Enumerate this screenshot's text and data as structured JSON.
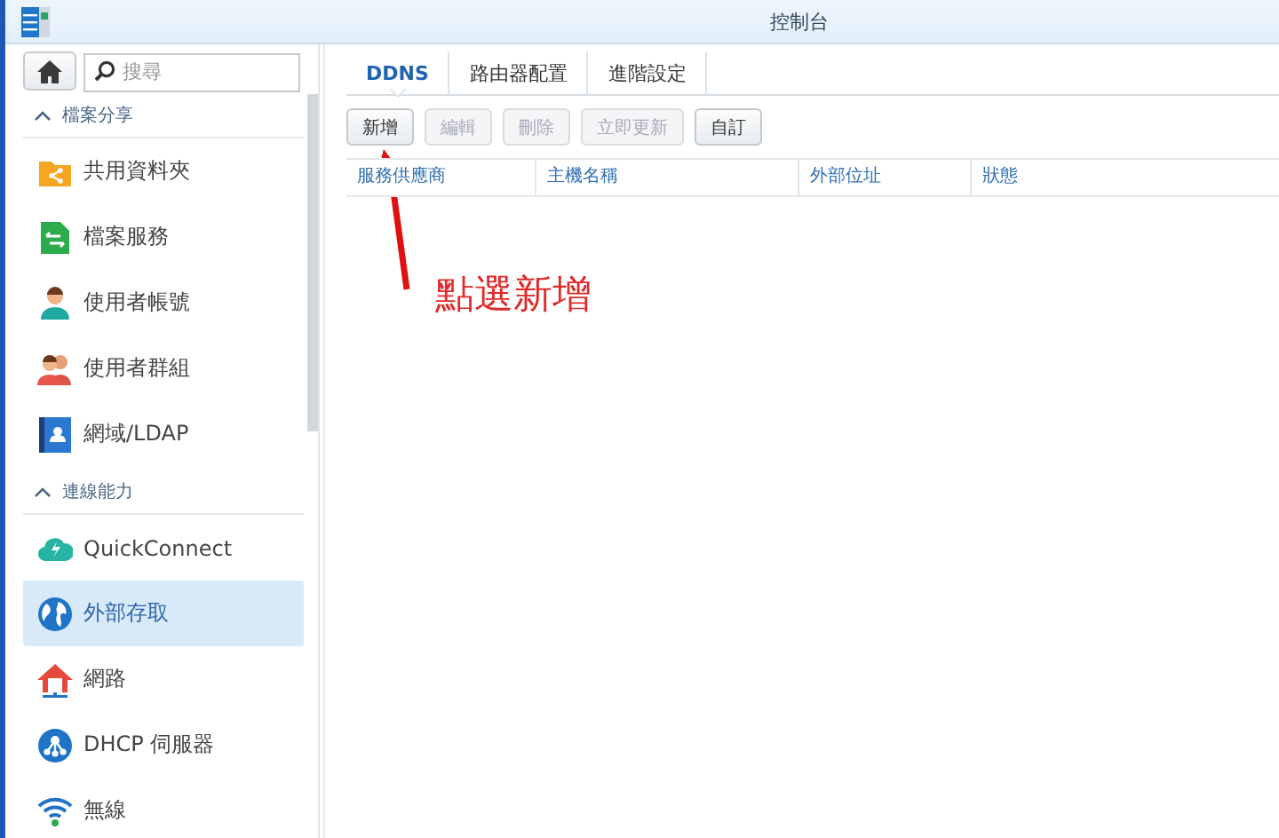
{
  "window": {
    "title": "控制台"
  },
  "search": {
    "placeholder": "搜尋"
  },
  "sidebar": {
    "sections": [
      {
        "label": "檔案分享",
        "expanded": true,
        "items": [
          {
            "label": "共用資料夾",
            "selected": false
          },
          {
            "label": "檔案服務",
            "selected": false
          },
          {
            "label": "使用者帳號",
            "selected": false
          },
          {
            "label": "使用者群組",
            "selected": false
          },
          {
            "label": "網域/LDAP",
            "selected": false
          }
        ]
      },
      {
        "label": "連線能力",
        "expanded": true,
        "items": [
          {
            "label": "QuickConnect",
            "selected": false
          },
          {
            "label": "外部存取",
            "selected": true
          },
          {
            "label": "網路",
            "selected": false
          },
          {
            "label": "DHCP 伺服器",
            "selected": false
          },
          {
            "label": "無線",
            "selected": false
          }
        ]
      }
    ]
  },
  "tabs": [
    {
      "label": "DDNS",
      "selected": true
    },
    {
      "label": "路由器配置",
      "selected": false
    },
    {
      "label": "進階設定",
      "selected": false
    }
  ],
  "toolbar": [
    {
      "label": "新增",
      "disabled": false
    },
    {
      "label": "編輯",
      "disabled": true
    },
    {
      "label": "刪除",
      "disabled": true
    },
    {
      "label": "立即更新",
      "disabled": true
    },
    {
      "label": "自訂",
      "disabled": false
    }
  ],
  "table": {
    "columns": [
      "服務供應商",
      "主機名稱",
      "外部位址",
      "狀態"
    ]
  },
  "annotation": {
    "text": "點選新增"
  }
}
